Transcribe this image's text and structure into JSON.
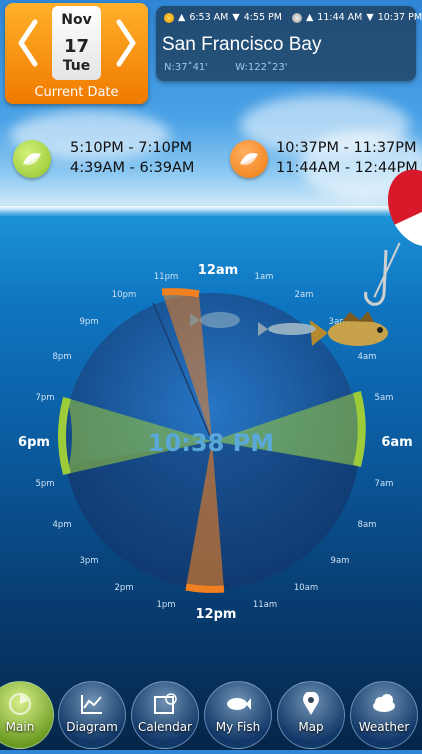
{
  "date": {
    "month": "Nov",
    "day": "17",
    "weekday": "Tue",
    "caption": "Current Date"
  },
  "location": {
    "sunrise": "6:53 AM",
    "sunset": "4:55 PM",
    "moonrise": "11:44 AM",
    "moonset": "10:37 PM",
    "name": "San Francisco Bay",
    "lat": "N:37˚41'",
    "lon": "W:122˚23'"
  },
  "periods": {
    "major_1": "5:10PM - 7:10PM",
    "major_2": "4:39AM - 6:39AM",
    "minor_1": "10:37PM - 11:37PM",
    "minor_2": "11:44AM - 12:44PM"
  },
  "dial": {
    "current_time": "10:38 PM",
    "label_12am": "12am",
    "label_6am": "6am",
    "label_12pm": "12pm",
    "label_6pm": "6pm",
    "hour_labels": [
      "1am",
      "2am",
      "3am",
      "4am",
      "5am",
      "7am",
      "8am",
      "9am",
      "10am",
      "11am",
      "1pm",
      "2pm",
      "3pm",
      "4pm",
      "5pm",
      "7pm",
      "8pm",
      "9pm",
      "10pm",
      "11pm"
    ]
  },
  "tabs": [
    {
      "label": "Main",
      "icon": "main-icon",
      "active": true
    },
    {
      "label": "Diagram",
      "icon": "diagram-icon",
      "active": false
    },
    {
      "label": "Calendar",
      "icon": "calendar-icon",
      "active": false
    },
    {
      "label": "My Fish",
      "icon": "fish-icon",
      "active": false
    },
    {
      "label": "Map",
      "icon": "map-pin-icon",
      "active": false
    },
    {
      "label": "Weather",
      "icon": "weather-icon",
      "active": false
    }
  ],
  "colors": {
    "major_period": "#9ccc3a",
    "minor_period": "#f08020",
    "dial_fill": "#1c5fa8"
  }
}
